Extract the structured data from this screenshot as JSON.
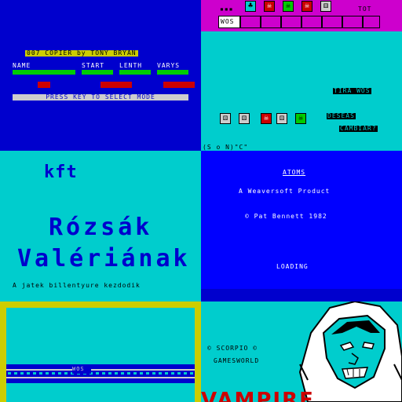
{
  "copier": {
    "title": "007 COPIER by TONY BRYAN",
    "headers": [
      "NAME",
      "START",
      "LENTH",
      "VARYS"
    ],
    "prompt": "PRESS KEY TO SELECT MODE"
  },
  "dice_game": {
    "top_label_left": "▪▪▪",
    "top_label_right": "TOT",
    "row_label": "WOS",
    "tira_label": "TIRA WOS",
    "deseas_label": "DESEAS",
    "cambiar_label": "CAMBIAR?",
    "answer_prompt": "(S o N)\"C\"",
    "top_dice": [
      "♣",
      "☠",
      "☠",
      "☠",
      "⚅"
    ],
    "bottom_dice": [
      "⚄",
      "⚄",
      "☠",
      "⚄",
      "☠"
    ],
    "colors": {
      "magenta": "#cd00cd",
      "cyan": "#00cdcd",
      "red": "#cd0000",
      "green": "#00cd00"
    }
  },
  "kft": {
    "logo": "kft",
    "line1": "Rózsák",
    "line2": "Valériának",
    "footer": "A jatek billentyure kezdodik"
  },
  "atoms": {
    "title": "ATOMS",
    "line1": "A Weaversoft Product",
    "line2": "© Pat Bennett 1982",
    "status": "LOADING"
  },
  "loader": {
    "stripe_label": "WOS"
  },
  "vampire": {
    "line1": "© SCORPIO ©",
    "line2": "GAMESWORLD",
    "logo": "VAMPIRE"
  }
}
